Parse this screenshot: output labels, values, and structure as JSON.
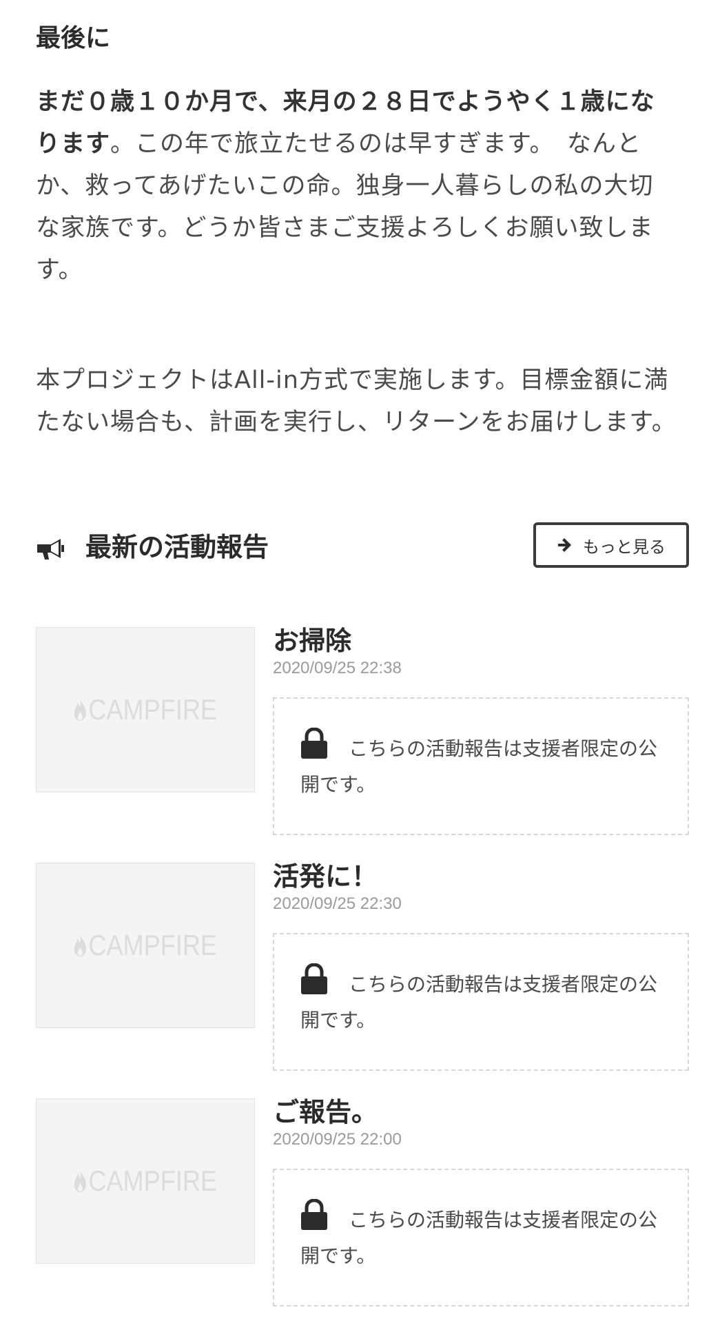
{
  "closing": {
    "heading": "最後に",
    "para1_bold_lead": "まだ０歳１０か月で、来月の２８日でようやく１歳になります",
    "para1_rest": "。この年で旅立たせるのは早すぎます。　なんとか、救ってあげたいこの命。独身一人暮らしの私の大切な家族です。どうか皆さまご支援よろしくお願い致します。",
    "para2": "本プロジェクトはAll-in方式で実施します。目標金額に満たない場合も、計画を実行し、リターンをお届けします。"
  },
  "reports": {
    "title": "最新の活動報告",
    "more_label": "もっと見る",
    "thumbnail_logo": "CAMPFIRE",
    "items": [
      {
        "title": "お掃除",
        "date": "2020/09/25 22:38",
        "locked_text": "こちらの活動報告は支援者限定の公開です。"
      },
      {
        "title": "活発に！",
        "date": "2020/09/25 22:30",
        "locked_text": "こちらの活動報告は支援者限定の公開です。"
      },
      {
        "title": "ご報告。",
        "date": "2020/09/25 22:00",
        "locked_text": "こちらの活動報告は支援者限定の公開です。"
      }
    ]
  },
  "icons": {
    "megaphone": "megaphone-icon",
    "arrow": "arrow-right-icon",
    "lock": "lock-icon",
    "flame": "campfire-flame-icon"
  }
}
